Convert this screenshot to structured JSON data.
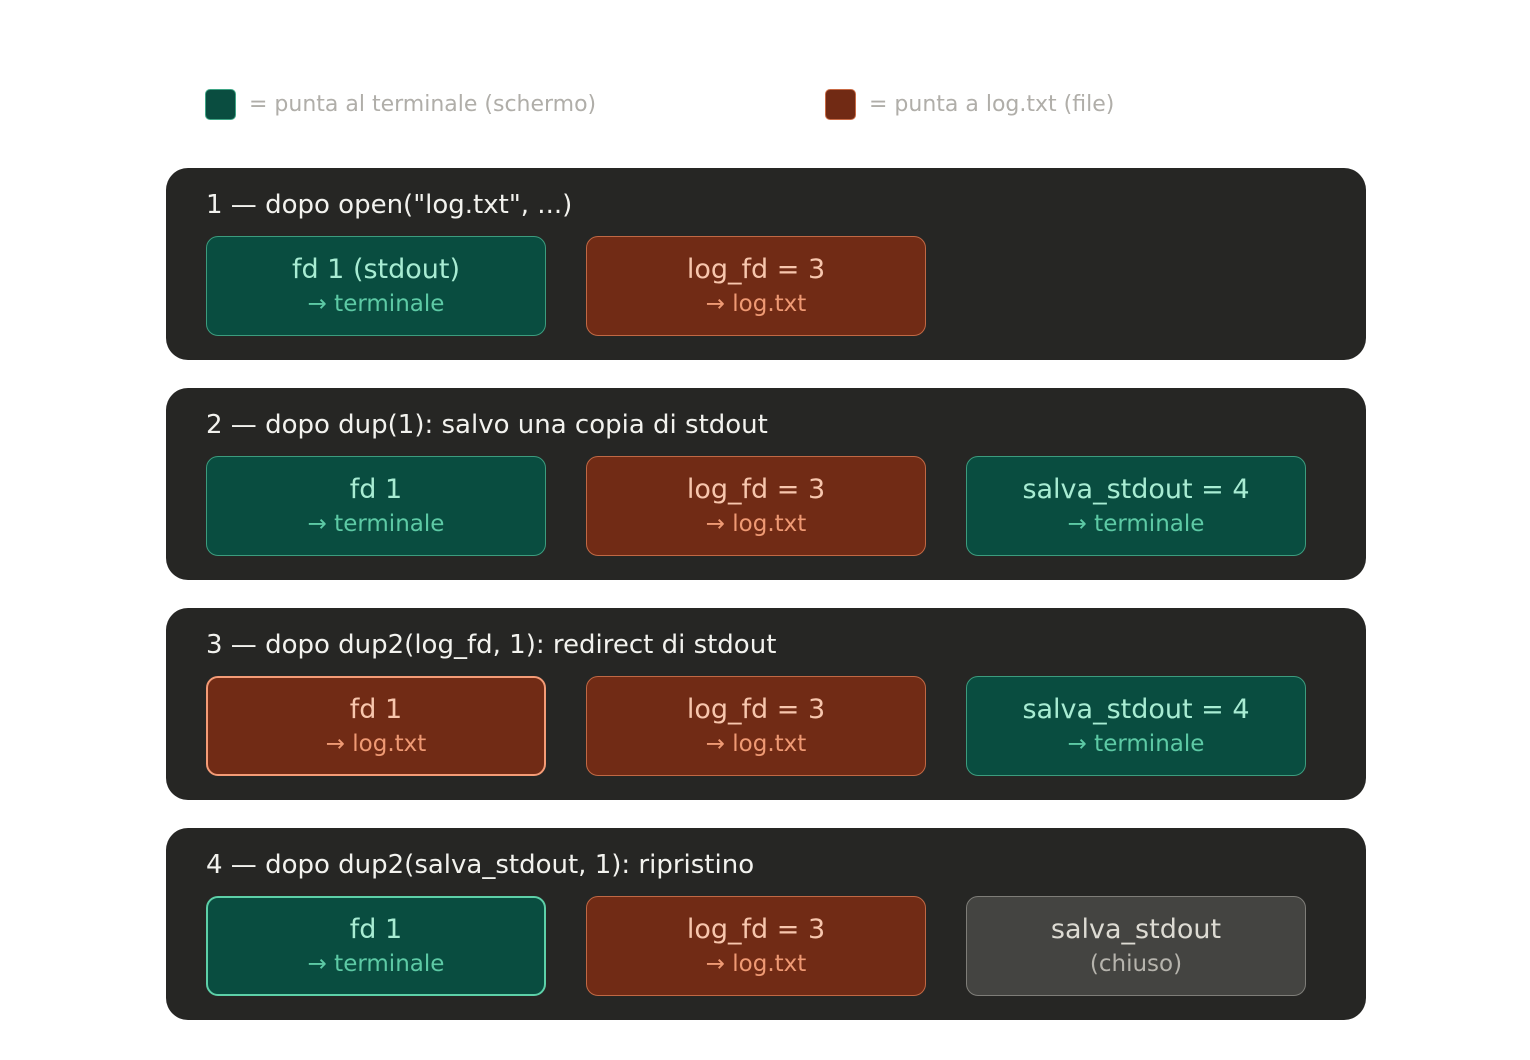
{
  "legend": [
    {
      "label": "= punta al terminale (schermo)",
      "color": "#0a4d40"
    },
    {
      "label": "= punta a log.txt (file)",
      "color": "#712a14"
    }
  ],
  "colors": {
    "terminal": "#094d40",
    "file": "#712b15",
    "closed": "#444441",
    "panel": "#262624"
  },
  "steps": [
    {
      "title": "1 — dopo open(\"log.txt\", ...)",
      "boxes": [
        {
          "label": "fd 1 (stdout)",
          "target": "→ terminale",
          "kind": "terminal"
        },
        {
          "label": "log_fd = 3",
          "target": "→ log.txt",
          "kind": "file"
        }
      ]
    },
    {
      "title": "2 — dopo dup(1): salvo una copia di stdout",
      "boxes": [
        {
          "label": "fd 1",
          "target": "→ terminale",
          "kind": "terminal"
        },
        {
          "label": "log_fd = 3",
          "target": "→ log.txt",
          "kind": "file"
        },
        {
          "label": "salva_stdout = 4",
          "target": "→ terminale",
          "kind": "terminal"
        }
      ]
    },
    {
      "title": "3 — dopo dup2(log_fd, 1): redirect di stdout",
      "boxes": [
        {
          "label": "fd 1",
          "target": "→ log.txt",
          "kind": "file",
          "highlighted": true
        },
        {
          "label": "log_fd = 3",
          "target": "→ log.txt",
          "kind": "file"
        },
        {
          "label": "salva_stdout = 4",
          "target": "→ terminale",
          "kind": "terminal"
        }
      ]
    },
    {
      "title": "4 — dopo dup2(salva_stdout, 1): ripristino",
      "boxes": [
        {
          "label": "fd 1",
          "target": "→ terminale",
          "kind": "terminal",
          "highlighted": true
        },
        {
          "label": "log_fd = 3",
          "target": "→ log.txt",
          "kind": "file"
        },
        {
          "label": "salva_stdout",
          "target": "(chiuso)",
          "kind": "closed"
        }
      ]
    }
  ]
}
